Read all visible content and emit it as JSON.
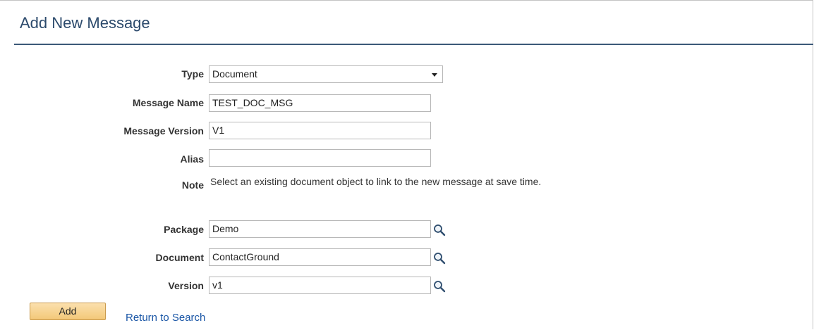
{
  "page": {
    "title": "Add New Message"
  },
  "form": {
    "type": {
      "label": "Type",
      "value": "Document"
    },
    "message_name": {
      "label": "Message Name",
      "value": "TEST_DOC_MSG"
    },
    "message_version": {
      "label": "Message Version",
      "value": "V1"
    },
    "alias": {
      "label": "Alias",
      "value": ""
    },
    "note": {
      "label": "Note",
      "text": "Select an existing document object to link to the new message at save time."
    },
    "package": {
      "label": "Package",
      "value": "Demo"
    },
    "document": {
      "label": "Document",
      "value": "ContactGround"
    },
    "version": {
      "label": "Version",
      "value": "v1"
    }
  },
  "actions": {
    "add_label": "Add",
    "return_label": "Return to Search"
  },
  "icons": {
    "lookup": "search-icon"
  }
}
